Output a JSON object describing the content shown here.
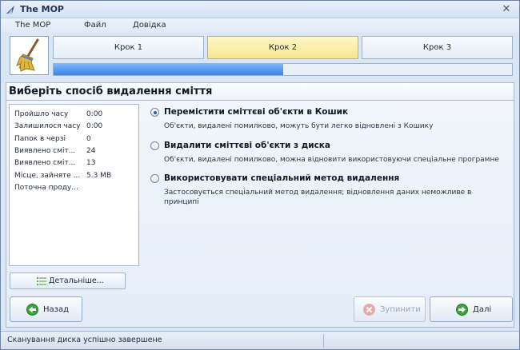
{
  "window": {
    "title": "The MOP"
  },
  "menu": [
    "The MOP",
    "Файл",
    "Довідка"
  ],
  "steps": [
    {
      "label": "Крок 1",
      "active": false
    },
    {
      "label": "Крок 2",
      "active": true
    },
    {
      "label": "Крок 3",
      "active": false
    }
  ],
  "progress": {
    "fraction": 0.5
  },
  "heading": "Виберіть спосіб видалення сміття",
  "stats": [
    {
      "label": "Пройшло часу",
      "value": "0:00"
    },
    {
      "label": "Залишилося часу",
      "value": "0:00"
    },
    {
      "label": "Папок в черзі",
      "value": "0"
    },
    {
      "label": "Виявлено сміт...",
      "value": "24"
    },
    {
      "label": "Виявлено сміт...",
      "value": "13"
    },
    {
      "label": "Місце, зайняте ...",
      "value": "5.3 MB"
    },
    {
      "label": "Поточна проду...",
      "value": ""
    }
  ],
  "details_button": "Детальніше...",
  "options": [
    {
      "title": "Перемістити сміттєві об'єкти в Кошик",
      "desc": "Об'єкти, видалені помилково, можуть бути легко відновлені з Кошику",
      "checked": true
    },
    {
      "title": "Видалити сміттєві об'єкти з диска",
      "desc": "Об'єкти, видалені помилково, можна відновити використовуючи спеціальне програмне",
      "checked": false
    },
    {
      "title": "Використовувати спеціальний метод видалення",
      "desc": "Застосовується спеціальний метод видалення; відновлення даних неможливе в принципі",
      "checked": false
    }
  ],
  "buttons": {
    "back": "Назад",
    "stop": "Зупинити",
    "next": "Далі"
  },
  "status": {
    "text": "Сканування диска успішно завершене"
  },
  "colors": {
    "accent": "#3a82ea",
    "active_step": "#f6e690",
    "go_icon": "#3aa43a",
    "stop_icon": "#d94a4a"
  }
}
